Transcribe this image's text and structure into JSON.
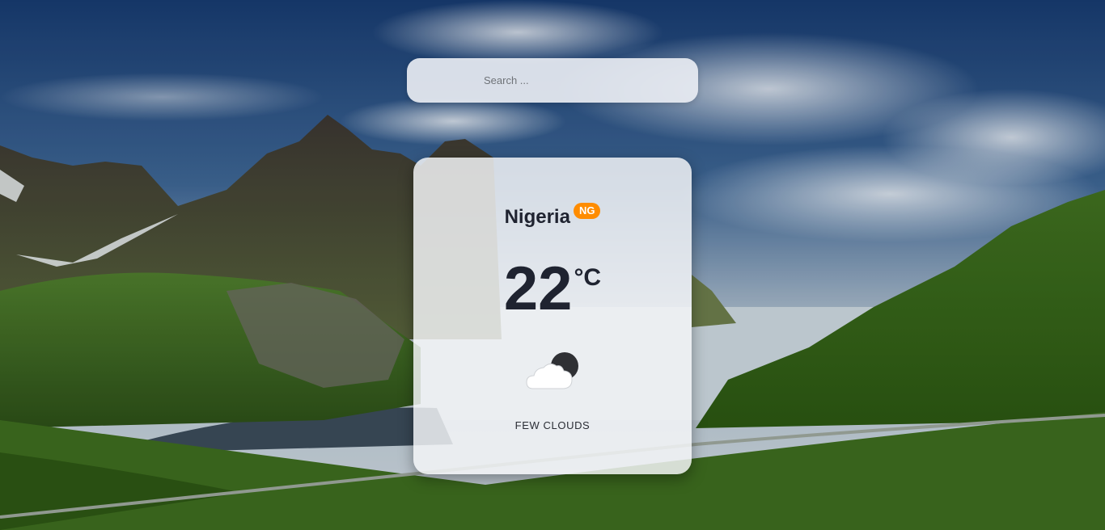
{
  "search": {
    "placeholder": "Search ...",
    "value": ""
  },
  "weather": {
    "city": "Nigeria",
    "country_code": "NG",
    "temperature": "22",
    "unit": "°C",
    "description": "FEW CLOUDS",
    "icon": "few-clouds-night-icon"
  },
  "colors": {
    "badge": "#ff8c00",
    "text": "#1f2330"
  }
}
